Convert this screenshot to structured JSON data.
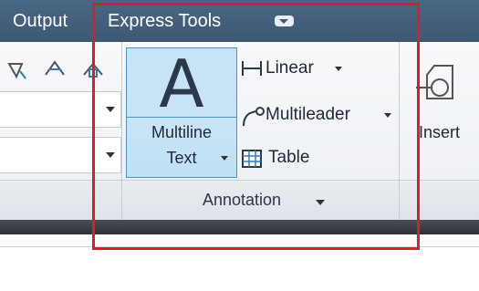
{
  "tabs": [
    {
      "label": "Output"
    },
    {
      "label": "Express Tools"
    }
  ],
  "annotation_panel": {
    "title": "Annotation",
    "multiline_text": {
      "line1": "Multiline",
      "line2": "Text",
      "glyph": "A"
    },
    "linear": {
      "label": "Linear"
    },
    "multileader": {
      "label": "Multileader"
    },
    "table": {
      "label": "Table"
    }
  },
  "insert_panel": {
    "label": "Insert"
  },
  "colors": {
    "tab_bar": "#3d5874",
    "active_button": "#c7e4f7",
    "highlight_box": "#d4202a"
  }
}
